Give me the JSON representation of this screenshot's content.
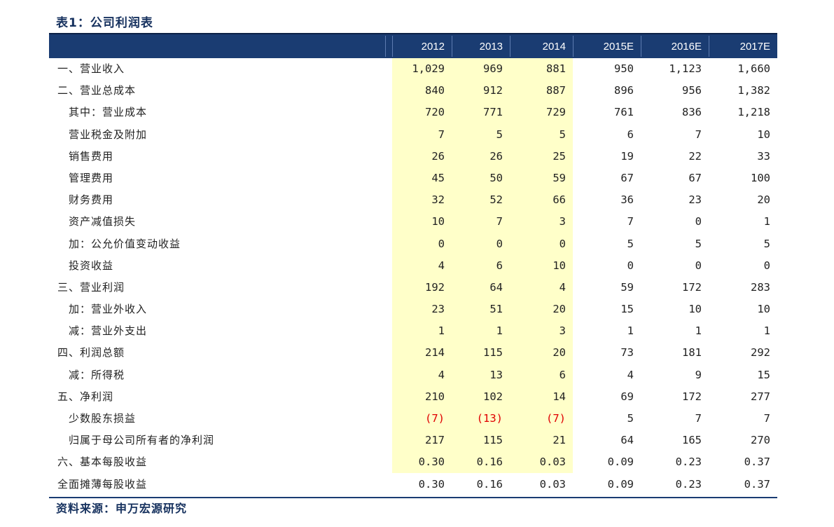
{
  "title": "表1：公司利润表",
  "source": "资料来源：申万宏源研究",
  "header": [
    "2012",
    "2013",
    "2014",
    "2015E",
    "2016E",
    "2017E"
  ],
  "rows": [
    {
      "label": "一、营业收入",
      "indent": false,
      "values": [
        "1,029",
        "969",
        "881",
        "950",
        "1,123",
        "1,660"
      ]
    },
    {
      "label": "二、营业总成本",
      "indent": false,
      "values": [
        "840",
        "912",
        "887",
        "896",
        "956",
        "1,382"
      ]
    },
    {
      "label": "其中：营业成本",
      "indent": true,
      "values": [
        "720",
        "771",
        "729",
        "761",
        "836",
        "1,218"
      ]
    },
    {
      "label": "营业税金及附加",
      "indent": true,
      "values": [
        "7",
        "5",
        "5",
        "6",
        "7",
        "10"
      ]
    },
    {
      "label": "销售费用",
      "indent": true,
      "values": [
        "26",
        "26",
        "25",
        "19",
        "22",
        "33"
      ]
    },
    {
      "label": "管理费用",
      "indent": true,
      "values": [
        "45",
        "50",
        "59",
        "67",
        "67",
        "100"
      ]
    },
    {
      "label": "财务费用",
      "indent": true,
      "values": [
        "32",
        "52",
        "66",
        "36",
        "23",
        "20"
      ]
    },
    {
      "label": "资产减值损失",
      "indent": true,
      "values": [
        "10",
        "7",
        "3",
        "7",
        "0",
        "1"
      ]
    },
    {
      "label": "加：公允价值变动收益",
      "indent": true,
      "values": [
        "0",
        "0",
        "0",
        "5",
        "5",
        "5"
      ]
    },
    {
      "label": "投资收益",
      "indent": true,
      "values": [
        "4",
        "6",
        "10",
        "0",
        "0",
        "0"
      ]
    },
    {
      "label": "三、营业利润",
      "indent": false,
      "values": [
        "192",
        "64",
        "4",
        "59",
        "172",
        "283"
      ]
    },
    {
      "label": "加：营业外收入",
      "indent": true,
      "values": [
        "23",
        "51",
        "20",
        "15",
        "10",
        "10"
      ]
    },
    {
      "label": "减：营业外支出",
      "indent": true,
      "values": [
        "1",
        "1",
        "3",
        "1",
        "1",
        "1"
      ]
    },
    {
      "label": "四、利润总额",
      "indent": false,
      "values": [
        "214",
        "115",
        "20",
        "73",
        "181",
        "292"
      ]
    },
    {
      "label": "减：所得税",
      "indent": true,
      "values": [
        "4",
        "13",
        "6",
        "4",
        "9",
        "15"
      ]
    },
    {
      "label": "五、净利润",
      "indent": false,
      "values": [
        "210",
        "102",
        "14",
        "69",
        "172",
        "277"
      ]
    },
    {
      "label": "少数股东损益",
      "indent": true,
      "values": [
        "(7)",
        "(13)",
        "(7)",
        "5",
        "7",
        "7"
      ]
    },
    {
      "label": "归属于母公司所有者的净利润",
      "indent": true,
      "values": [
        "217",
        "115",
        "21",
        "64",
        "165",
        "270"
      ]
    },
    {
      "label": "六、基本每股收益",
      "indent": false,
      "values": [
        "0.30",
        "0.16",
        "0.03",
        "0.09",
        "0.23",
        "0.37"
      ]
    },
    {
      "label": "全面摊薄每股收益",
      "indent": false,
      "values": [
        "0.30",
        "0.16",
        "0.03",
        "0.09",
        "0.23",
        "0.37"
      ]
    }
  ],
  "colors": {
    "header_bg": "#1a3c72",
    "highlight": "#ffffc9",
    "negative": "#e00000",
    "title": "#16315e"
  }
}
